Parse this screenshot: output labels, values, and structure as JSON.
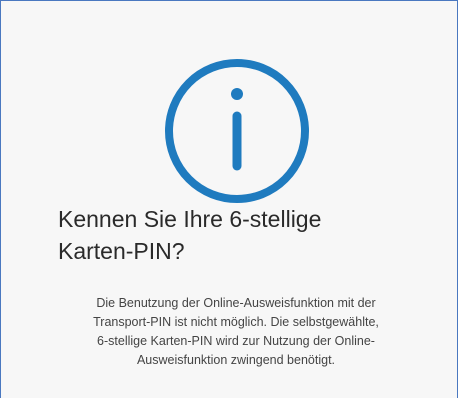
{
  "dialog": {
    "icon": "info-circle-icon",
    "accent_color": "#1f7bbf",
    "title_line1": "Kennen Sie Ihre 6-stellige",
    "title_line2": "Karten-PIN?",
    "body_line1": "Die Benutzung der Online-Ausweisfunktion mit der",
    "body_line2": "Transport-PIN ist nicht möglich. Die selbstgewählte,",
    "body_line3": "6-stellige Karten-PIN wird zur Nutzung der Online-",
    "body_line4": "Ausweisfunktion zwingend benötigt."
  }
}
